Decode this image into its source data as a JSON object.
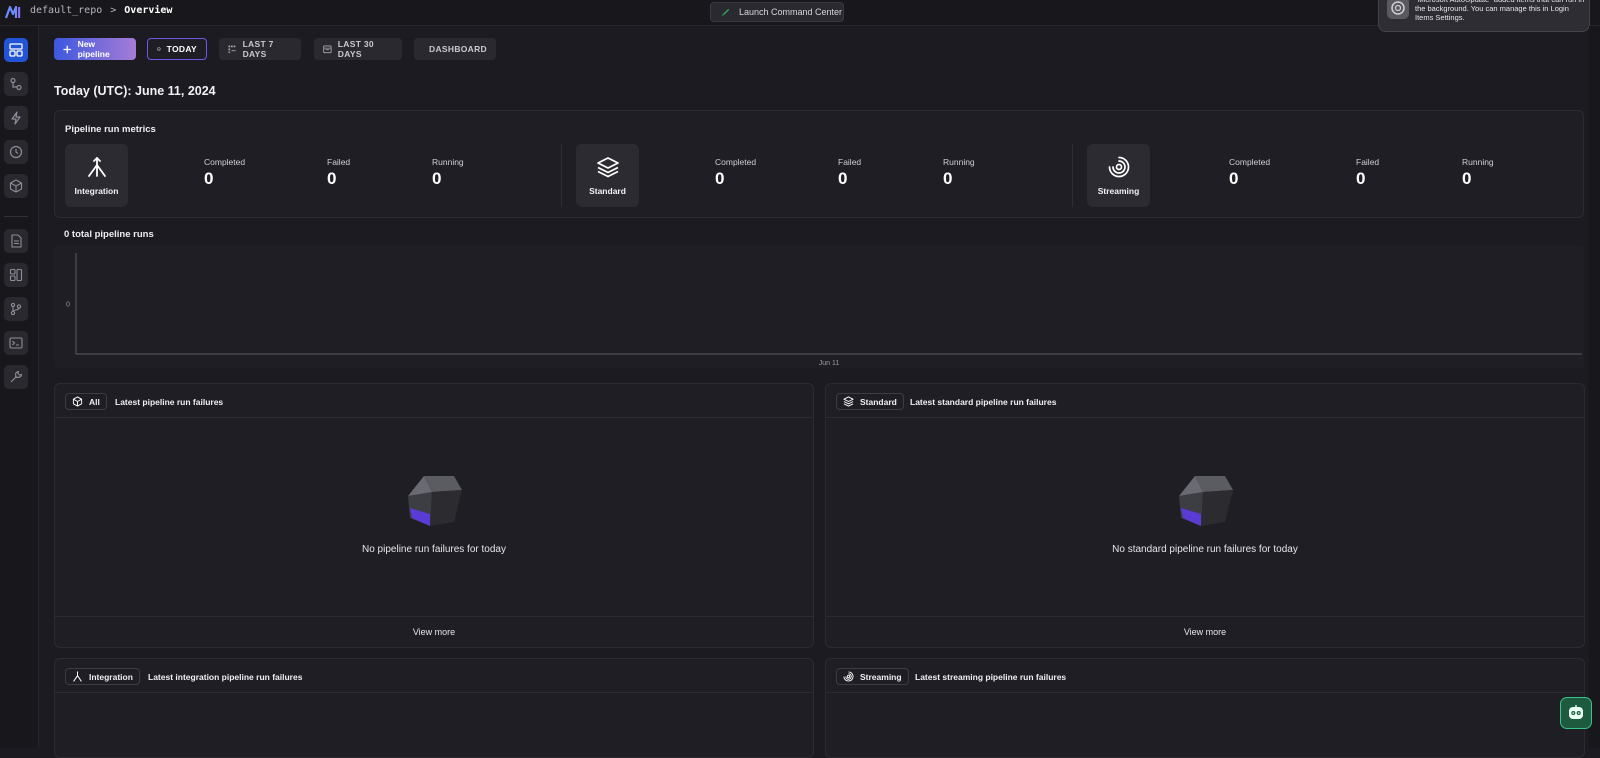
{
  "topbar": {
    "repo": "default_repo",
    "separator": ">",
    "current": "Overview",
    "launch_label": "Launch Command Center"
  },
  "notification": {
    "text": "“Microsoft AutoUpdate” added items that can run in the background. You can manage this in Login Items Settings."
  },
  "sidebar": {
    "items": [
      {
        "icon": "layout-icon",
        "active": true
      },
      {
        "icon": "pipeline-icon",
        "active": false
      },
      {
        "icon": "trigger-icon",
        "active": false
      },
      {
        "icon": "clock-icon",
        "active": false
      },
      {
        "icon": "block-icon",
        "active": false
      },
      {
        "icon": "document-icon",
        "active": false
      },
      {
        "icon": "blocks-icon",
        "active": false
      },
      {
        "icon": "git-branch-icon",
        "active": false
      },
      {
        "icon": "terminal-icon",
        "active": false
      },
      {
        "icon": "wrench-icon",
        "active": false
      }
    ]
  },
  "nav": {
    "new_pipeline": "New pipeline",
    "today": "TODAY",
    "last7": "LAST 7 DAYS",
    "last30": "LAST 30 DAYS",
    "dashboard": "DASHBOARD"
  },
  "page_title": "Today (UTC): June 11, 2024",
  "metrics": {
    "title": "Pipeline run metrics",
    "groups": [
      {
        "name": "Integration",
        "icon": "integration-icon",
        "completed_label": "Completed",
        "completed": "0",
        "failed_label": "Failed",
        "failed": "0",
        "running_label": "Running",
        "running": "0"
      },
      {
        "name": "Standard",
        "icon": "layers-icon",
        "completed_label": "Completed",
        "completed": "0",
        "failed_label": "Failed",
        "failed": "0",
        "running_label": "Running",
        "running": "0"
      },
      {
        "name": "Streaming",
        "icon": "streaming-icon",
        "completed_label": "Completed",
        "completed": "0",
        "failed_label": "Failed",
        "failed": "0",
        "running_label": "Running",
        "running": "0"
      }
    ]
  },
  "chart_data": {
    "type": "line",
    "title": "0 total pipeline runs",
    "categories": [
      "Jun 11"
    ],
    "series": [
      {
        "values": [
          0
        ]
      }
    ],
    "yticks": [
      "0"
    ],
    "xlabel": "",
    "ylabel": ""
  },
  "panels": [
    {
      "chip": "All",
      "chip_icon": "cube-icon",
      "title": "Latest pipeline run failures",
      "empty": "No pipeline run failures for today",
      "footer": "View more"
    },
    {
      "chip": "Standard",
      "chip_icon": "layers-icon",
      "title": "Latest standard pipeline run failures",
      "empty": "No standard pipeline run failures for today",
      "footer": "View more"
    },
    {
      "chip": "Integration",
      "chip_icon": "integration-icon",
      "title": "Latest integration pipeline run failures"
    },
    {
      "chip": "Streaming",
      "chip_icon": "streaming-icon",
      "title": "Latest streaming pipeline run failures"
    }
  ],
  "colors": {
    "accent": "#2454d6",
    "today_border": "#6f57e6",
    "assistant": "#37c58a"
  }
}
